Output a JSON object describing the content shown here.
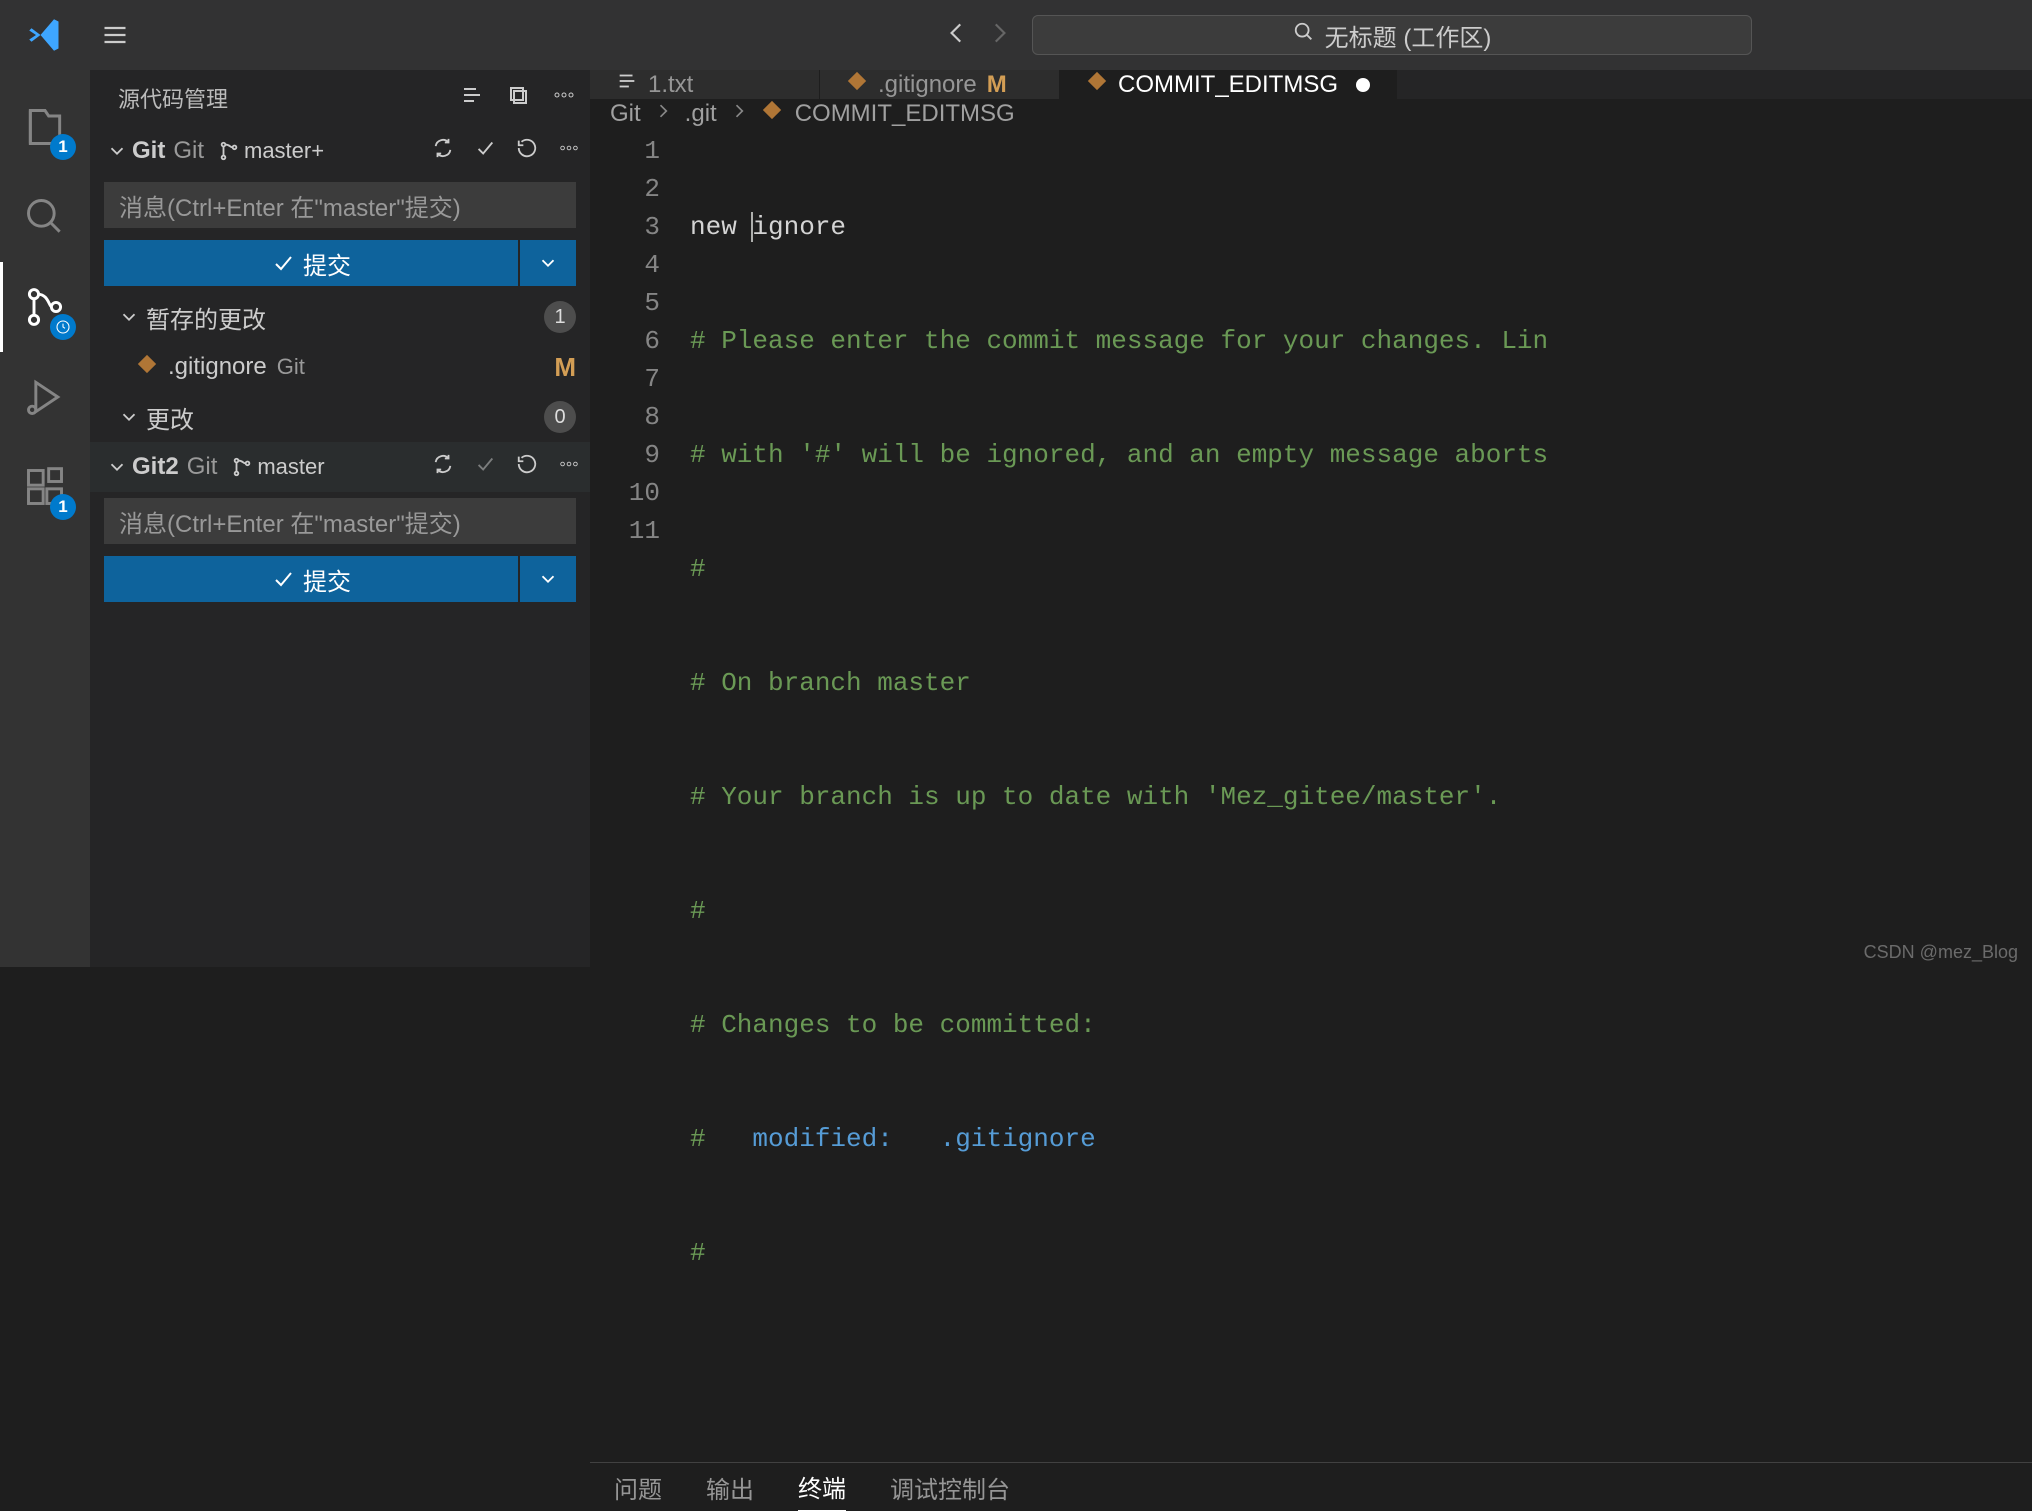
{
  "title_search": "无标题 (工作区)",
  "sidebar_title": "源代码管理",
  "activity": {
    "explorer_badge": "1",
    "extensions_badge": "1"
  },
  "repos": [
    {
      "name": "Git",
      "type": "Git",
      "branch": "master+",
      "commit_placeholder": "消息(Ctrl+Enter 在\"master\"提交)",
      "commit_label": "提交",
      "groups": [
        {
          "label": "暂存的更改",
          "count": "1",
          "files": [
            {
              "name": ".gitignore",
              "loc": "Git",
              "status": "M"
            }
          ]
        },
        {
          "label": "更改",
          "count": "0",
          "files": []
        }
      ]
    },
    {
      "name": "Git2",
      "type": "Git",
      "branch": "master",
      "commit_placeholder": "消息(Ctrl+Enter 在\"master\"提交)",
      "commit_label": "提交",
      "groups": []
    }
  ],
  "tabs": [
    {
      "label": "1.txt",
      "modified_flag": ""
    },
    {
      "label": ".gitignore",
      "modified_flag": "M"
    },
    {
      "label": "COMMIT_EDITMSG",
      "dirty": true
    }
  ],
  "breadcrumb": {
    "p1": "Git",
    "p2": ".git",
    "p3": "COMMIT_EDITMSG"
  },
  "editor_content": {
    "line1": "new ignore",
    "cmt1": "# Please enter the commit message for your changes. Lin",
    "cmt2": "# with '#' will be ignored, and an empty message aborts",
    "cmt3": "#",
    "cmt4": "# On branch master",
    "cmt5": "# Your branch is up to date with 'Mez_gitee/master'.",
    "cmt6": "#",
    "cmt7": "# Changes to be committed:",
    "cmt8_pre": "#   ",
    "cmt8_kw": "modified:",
    "cmt8_post": "   .gitignore",
    "cmt9": "#"
  },
  "panel_tabs": {
    "problems": "问题",
    "output": "输出",
    "terminal": "终端",
    "debug": "调试控制台"
  },
  "watermark": "CSDN @mez_Blog"
}
